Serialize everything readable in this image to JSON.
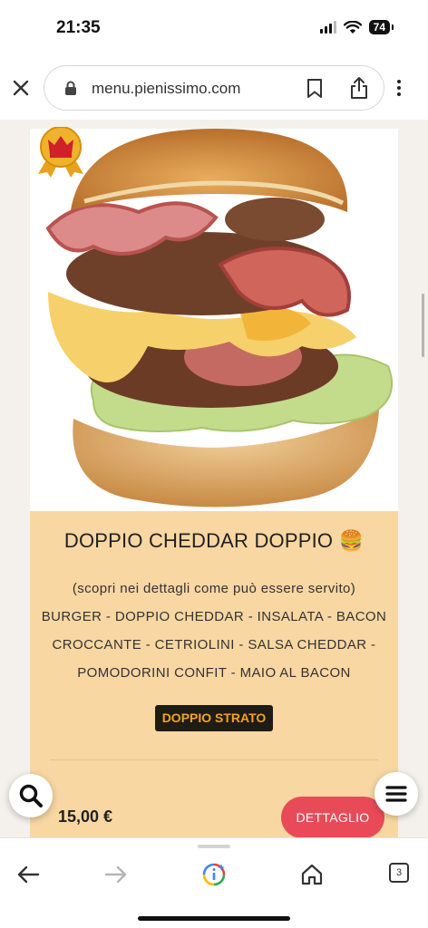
{
  "status_bar": {
    "time": "21:35",
    "battery": "74"
  },
  "browser": {
    "url": "menu.pienissimo.com",
    "tab_count": "3"
  },
  "product": {
    "title": "DOPPIO CHEDDAR DOPPIO 🍔",
    "description_lines": [
      "(scopri nei dettagli come può essere servito)",
      "BURGER - DOPPIO CHEDDAR - INSALATA - BACON",
      "CROCCANTE - CETRIOLINI - SALSA CHEDDAR -",
      "POMODORINI CONFIT - MAIO AL BACON"
    ],
    "tag": "DOPPIO STRATO",
    "price": "15,00 €",
    "detail_label": "DETTAGLIO"
  },
  "icons": {
    "close": "close-icon",
    "lock": "lock-icon",
    "bookmark": "bookmark-icon",
    "share": "share-icon",
    "more": "more-vertical-icon",
    "search": "search-icon",
    "menu": "hamburger-menu-icon",
    "back": "back-arrow-icon",
    "forward": "forward-arrow-icon",
    "assistant": "google-lens-icon",
    "home": "home-icon",
    "badge": "crown-badge-icon"
  },
  "colors": {
    "card": "#f8d7a3",
    "tag_bg": "#1f1b17",
    "tag_text": "#f5a31f",
    "detail_button": "#e84b57"
  }
}
